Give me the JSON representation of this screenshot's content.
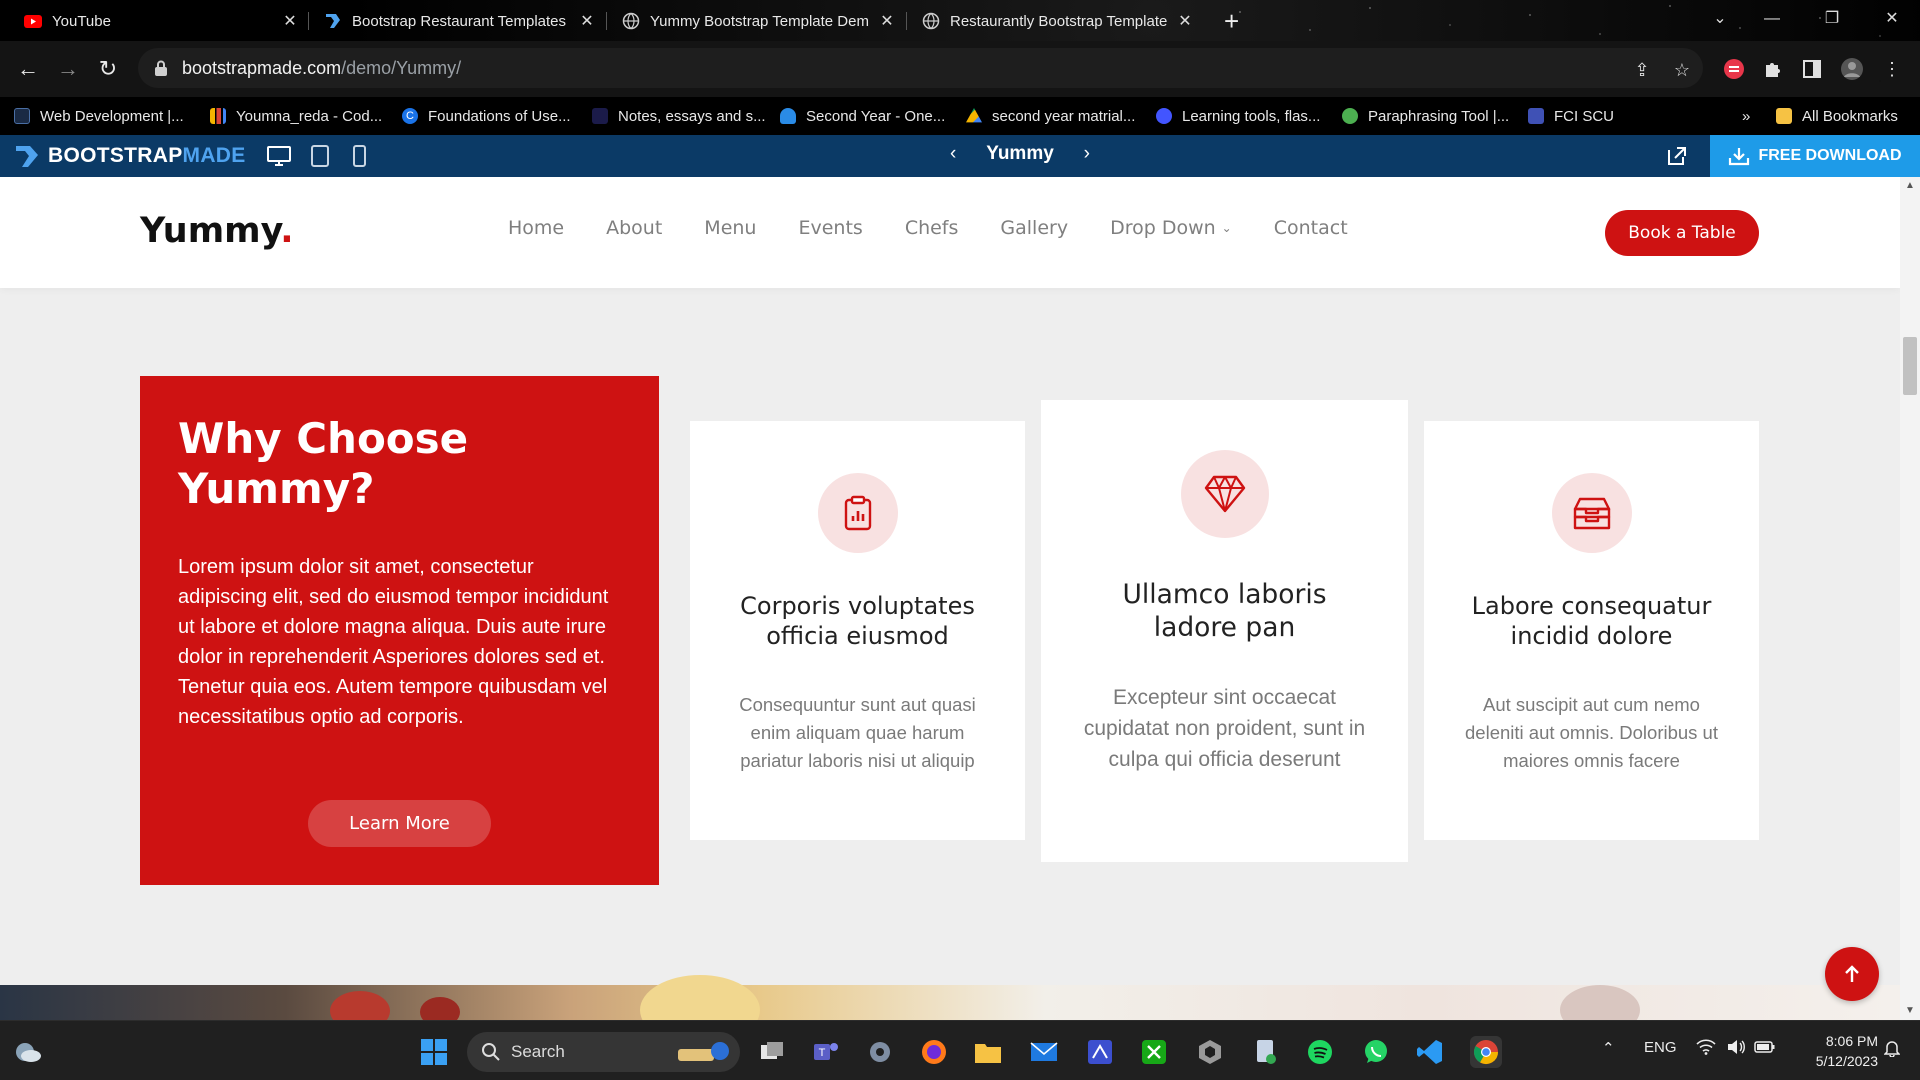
{
  "browser": {
    "tabs": [
      {
        "title": "YouTube",
        "icon": "youtube-icon"
      },
      {
        "title": "Bootstrap Restaurant Templates",
        "icon": "bootstrapmade-icon"
      },
      {
        "title": "Yummy Bootstrap Template Dem",
        "icon": "globe-icon"
      },
      {
        "title": "Restaurantly Bootstrap Template",
        "icon": "globe-icon"
      }
    ],
    "new_tab": "+",
    "url_host": "bootstrapmade.com",
    "url_path": "/demo/Yummy/",
    "bookmarks": [
      "Web Development |...",
      "Youmna_reda - Cod...",
      "Foundations of Use...",
      "Notes, essays and s...",
      "Second Year - One...",
      "second year matrial...",
      "Learning tools, flas...",
      "Paraphrasing Tool |...",
      "FCI SCU"
    ],
    "bookmarks_overflow": "»",
    "all_bookmarks": "All Bookmarks"
  },
  "bm_bar": {
    "brand_a": "BOOTSTRAP",
    "brand_b": "MADE",
    "template_name": "Yummy",
    "download_label": "FREE DOWNLOAD"
  },
  "site": {
    "logo": "Yummy",
    "logo_dot": ".",
    "nav": [
      "Home",
      "About",
      "Menu",
      "Events",
      "Chefs",
      "Gallery",
      "Drop Down",
      "Contact"
    ],
    "cta": "Book a Table",
    "why": {
      "title": "Why Choose Yummy?",
      "text": "Lorem ipsum dolor sit amet, consectetur adipiscing elit, sed do eiusmod tempor incididunt ut labore et dolore magna aliqua. Duis aute irure dolor in reprehenderit Asperiores dolores sed et. Tenetur quia eos. Autem tempore quibusdam vel necessitatibus optio ad corporis.",
      "button": "Learn More"
    },
    "boxes": [
      {
        "icon": "clipboard-data-icon",
        "title": "Corporis voluptates officia eiusmod",
        "text": "Consequuntur sunt aut quasi enim aliquam quae harum pariatur laboris nisi ut aliquip"
      },
      {
        "icon": "gem-icon",
        "title": "Ullamco laboris ladore pan",
        "text": "Excepteur sint occaecat cupidatat non proident, sunt in culpa qui officia deserunt"
      },
      {
        "icon": "inboxes-icon",
        "title": "Labore consequatur incidid dolore",
        "text": "Aut suscipit aut cum nemo deleniti aut omnis. Doloribus ut maiores omnis facere"
      }
    ],
    "accent": "#ce1212"
  },
  "taskbar": {
    "search_label": "Search",
    "language": "ENG",
    "time": "8:06 PM",
    "date": "5/12/2023"
  }
}
